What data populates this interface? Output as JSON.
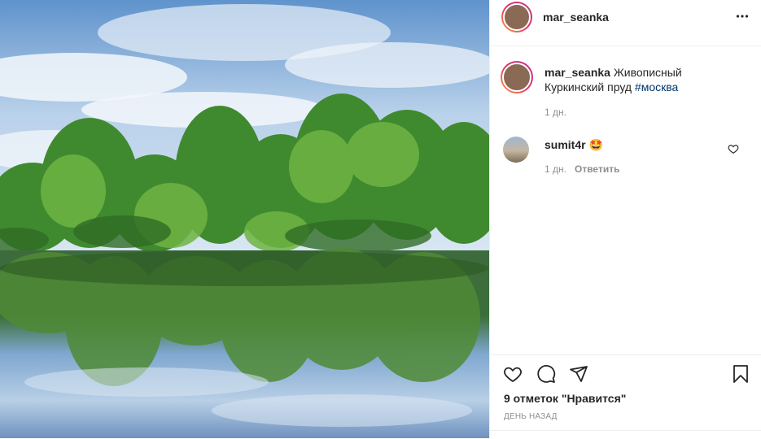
{
  "post": {
    "author": "mar_seanka",
    "caption_text": "Живописный Куркинский пруд",
    "hashtag": "#москва",
    "caption_time": "1 дн.",
    "more_icon": "more-horizontal-icon"
  },
  "comments": [
    {
      "username": "sumit4r",
      "emoji": "🤩",
      "time": "1 дн.",
      "reply_label": "Ответить"
    }
  ],
  "actions": {
    "icons": [
      "heart-icon",
      "comment-icon",
      "share-icon",
      "bookmark-icon"
    ],
    "likes_text": "9 отметок \"Нравится\"",
    "date_text": "ДЕНЬ НАЗАД"
  },
  "colors": {
    "text": "#262626",
    "secondary": "#8e8e8e",
    "hashtag": "#00376b",
    "border": "#efefef"
  }
}
